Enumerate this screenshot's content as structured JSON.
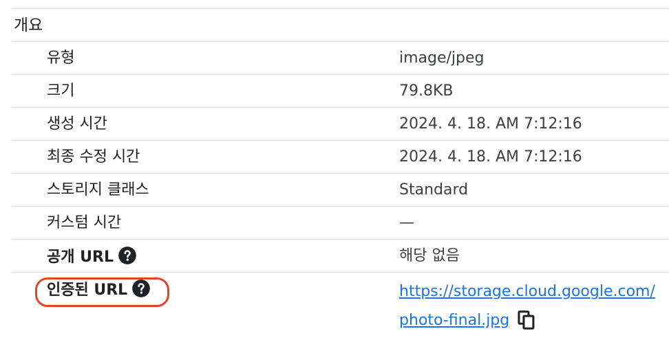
{
  "section": {
    "title": "개요"
  },
  "rows": [
    {
      "label": "유형",
      "value": "image/jpeg"
    },
    {
      "label": "크기",
      "value": "79.8KB"
    },
    {
      "label": "생성 시간",
      "value": "2024. 4. 18. AM 7:12:16"
    },
    {
      "label": "최종 수정 시간",
      "value": "2024. 4. 18. AM 7:12:16"
    },
    {
      "label": "스토리지 클래스",
      "value": "Standard"
    },
    {
      "label": "커스텀 시간",
      "value": "—"
    }
  ],
  "public_url": {
    "label": "공개 URL",
    "value": "해당 없음",
    "icon": "help-icon"
  },
  "authenticated_url": {
    "label": "인증된 URL",
    "icon": "help-icon",
    "link_line1": "https://storage.cloud.google.com/",
    "link_line2": "photo-final.jpg",
    "copy_icon": "copy-icon"
  },
  "colors": {
    "link": "#1a73e8",
    "highlight": "#e0452a",
    "divider": "#dadce0"
  }
}
